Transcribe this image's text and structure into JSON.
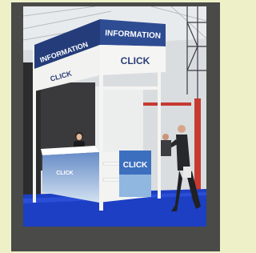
{
  "photo": {
    "sign_front": "INFORMATION",
    "sign_side": "INFORMATION",
    "brand_top_front": "CLICK",
    "brand_top_side": "CLICK",
    "brand_counter_front": "CLICK",
    "brand_counter_side": "CLICK"
  },
  "colors": {
    "frame": "#4a4a48",
    "page_bg": "#eef0c8",
    "floor_blue": "#1d3fc4",
    "sign_navy": "#243d7a"
  }
}
